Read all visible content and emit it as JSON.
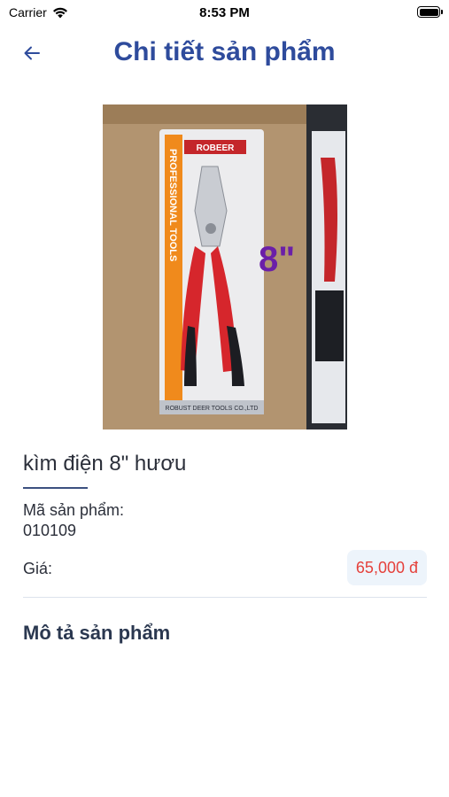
{
  "status_bar": {
    "carrier": "Carrier",
    "time": "8:53 PM",
    "battery_level": 1.0
  },
  "header": {
    "back_icon": "arrow-left-icon",
    "title": "Chi tiết sản phẩm",
    "title_color": "#2e4b9c"
  },
  "product": {
    "image_texts": {
      "size_overlay": "8\"",
      "brand": "ROBEER",
      "side_text": "PROFESSIONAL TOOLS",
      "bottom_text": "ROBUST DEER TOOLS CO.,LTD"
    },
    "name": "kìm điện 8\" hươu",
    "sku_label": "Mã sản phẩm:",
    "sku_value": "010109",
    "price_label": "Giá:",
    "price_value": "65,000 đ",
    "price_color": "#e5413b"
  },
  "description": {
    "heading": "Mô tả sản phẩm"
  }
}
